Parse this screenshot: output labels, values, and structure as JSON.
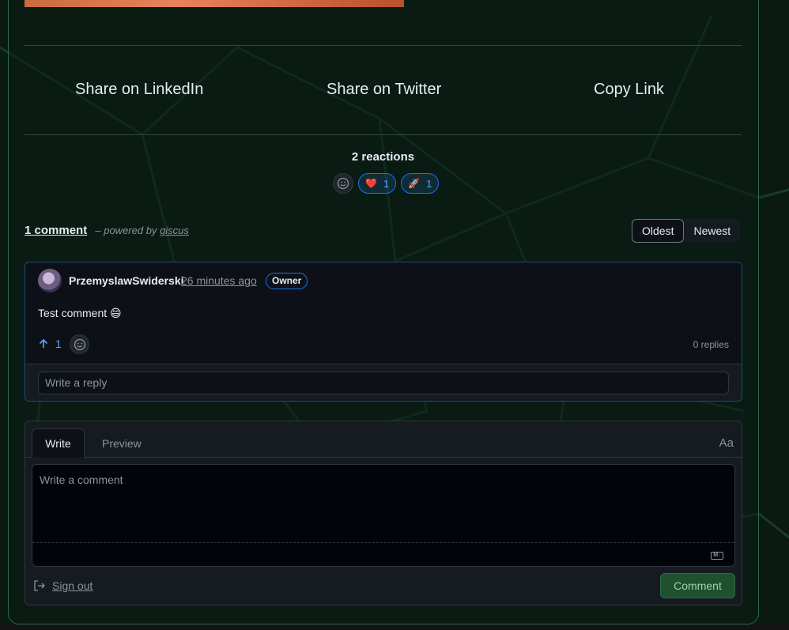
{
  "share": {
    "linkedin": "Share on LinkedIn",
    "twitter": "Share on Twitter",
    "copy": "Copy Link"
  },
  "reactions": {
    "title": "2 reactions",
    "items": [
      {
        "icon": "heart-icon",
        "emoji": "❤️",
        "count": "1"
      },
      {
        "icon": "rocket-icon",
        "emoji": "🚀",
        "count": "1"
      }
    ]
  },
  "comments": {
    "count_label": "1 comment",
    "powered_prefix": "– powered by",
    "powered_link": "giscus",
    "sort": {
      "oldest": "Oldest",
      "newest": "Newest",
      "active": "Oldest"
    }
  },
  "comment": {
    "author": "PrzemyslawSwiderski",
    "time": "26 minutes ago",
    "badge": "Owner",
    "text": "Test comment 😄",
    "upvotes": "1",
    "replies": "0 replies",
    "reply_placeholder": "Write a reply"
  },
  "composer": {
    "tab_write": "Write",
    "tab_preview": "Preview",
    "aa": "Aa",
    "placeholder": "Write a comment",
    "md": "M↓",
    "signout": "Sign out",
    "submit": "Comment"
  },
  "colors": {
    "background": "#0a1a12",
    "accent_blue": "#58a6ff",
    "comment_button": "#1f5130"
  }
}
